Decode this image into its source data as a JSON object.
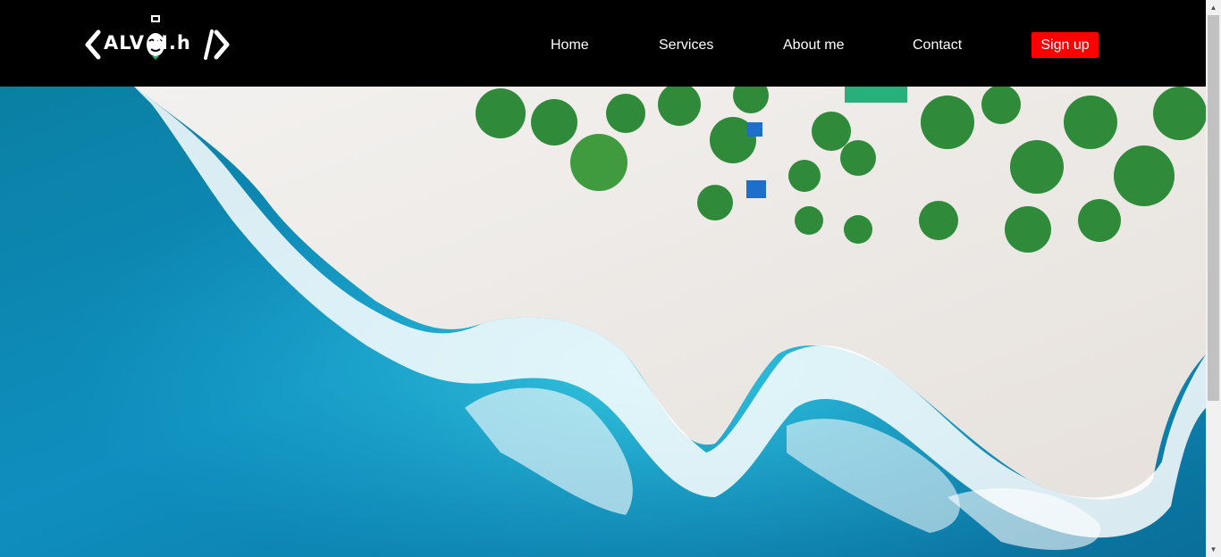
{
  "header": {
    "logo_text": "ALV N.h",
    "nav": [
      {
        "label": "Home"
      },
      {
        "label": "Services"
      },
      {
        "label": "About me"
      },
      {
        "label": "Contact"
      }
    ],
    "signup_label": "Sign up"
  },
  "hero": {
    "image": "aerial-beach-icon"
  },
  "scrollbar": {
    "up_icon": "▲",
    "down_icon": "▼"
  },
  "colors": {
    "header_bg": "#000000",
    "accent": "#ff0000",
    "text": "#ffffff"
  }
}
